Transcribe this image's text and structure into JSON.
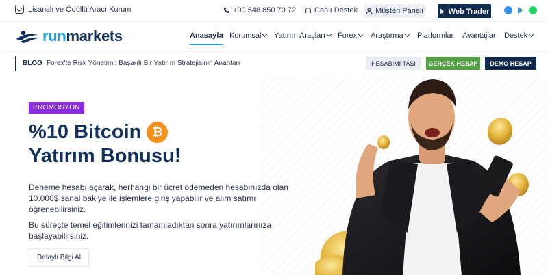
{
  "topbar": {
    "license_text": "Lisanslı ve Ödüllü Aracı Kurum",
    "phone": "+90 548 850 70 72",
    "live_support": "Canlı Destek",
    "client_panel": "Müşteri Paneli",
    "web_trader": "Web Trader",
    "stores": [
      "app-store-icon",
      "google-play-icon",
      "whatsapp-icon"
    ]
  },
  "nav": {
    "logo_run": "run",
    "logo_markets": "markets",
    "items": [
      {
        "label": "Anasayfa",
        "dropdown": false,
        "active": true
      },
      {
        "label": "Kurumsal",
        "dropdown": true
      },
      {
        "label": "Yatırım Araçları",
        "dropdown": true
      },
      {
        "label": "Forex",
        "dropdown": true
      },
      {
        "label": "Araştırma",
        "dropdown": true
      },
      {
        "label": "Platformlar",
        "dropdown": false
      },
      {
        "label": "Avantajlar",
        "dropdown": false
      },
      {
        "label": "Destek",
        "dropdown": true
      }
    ]
  },
  "blog": {
    "label": "BLOG",
    "headline": "Forex'te Risk Yönetimi: Başarılı Bir Yatırım Stratejisinin Anahtarı",
    "move_account": "HESABIMI TAŞI",
    "real_account": "GERÇEK HESAP",
    "demo_account": "DEMO HESAP"
  },
  "hero": {
    "badge": "PROMOSYON",
    "title_line1": "%10 Bitcoin",
    "title_line2": "Yatırım Bonusu!",
    "bitcoin_symbol": "₿",
    "desc1": "Deneme hesabı açarak, herhangi bir ücret ödemeden hesabınızda olan 10.000$ sanal bakiye ile işlemlere giriş yapabilir ve alım satımı öğrenebilirsiniz.",
    "desc2": "Bu süreçte temel eğitimlerinizi tamamladıktan sonra yatırımlarınıza başlayabilirsiniz.",
    "cta": "Detaylı Bilgi Al"
  },
  "colors": {
    "brand_navy": "#102a4c",
    "brand_blue": "#1ea0d8",
    "promo_purple": "#8b2be2",
    "real_green": "#55a043",
    "bitcoin_orange": "#f5921b"
  }
}
